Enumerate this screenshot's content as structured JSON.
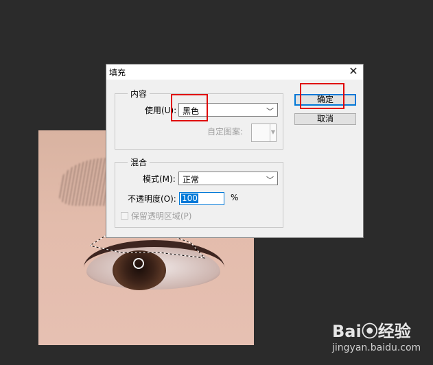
{
  "dialog": {
    "title": "填充",
    "close_glyph": "✕",
    "content_group": {
      "title": "内容",
      "use_label": "使用(U):",
      "use_value": "黑色",
      "pattern_label": "自定图案:"
    },
    "blend_group": {
      "title": "混合",
      "mode_label": "模式(M):",
      "mode_value": "正常",
      "opacity_label": "不透明度(O):",
      "opacity_value": "100",
      "opacity_unit": "%",
      "preserve_label": "保留透明区域(P)"
    },
    "buttons": {
      "ok": "确定",
      "cancel": "取消"
    }
  },
  "watermark": {
    "brand": "Bai⦿经验",
    "url": "jingyan.baidu.com"
  },
  "colors": {
    "highlight_box": "#e00000",
    "focus_accent": "#0078d7"
  }
}
